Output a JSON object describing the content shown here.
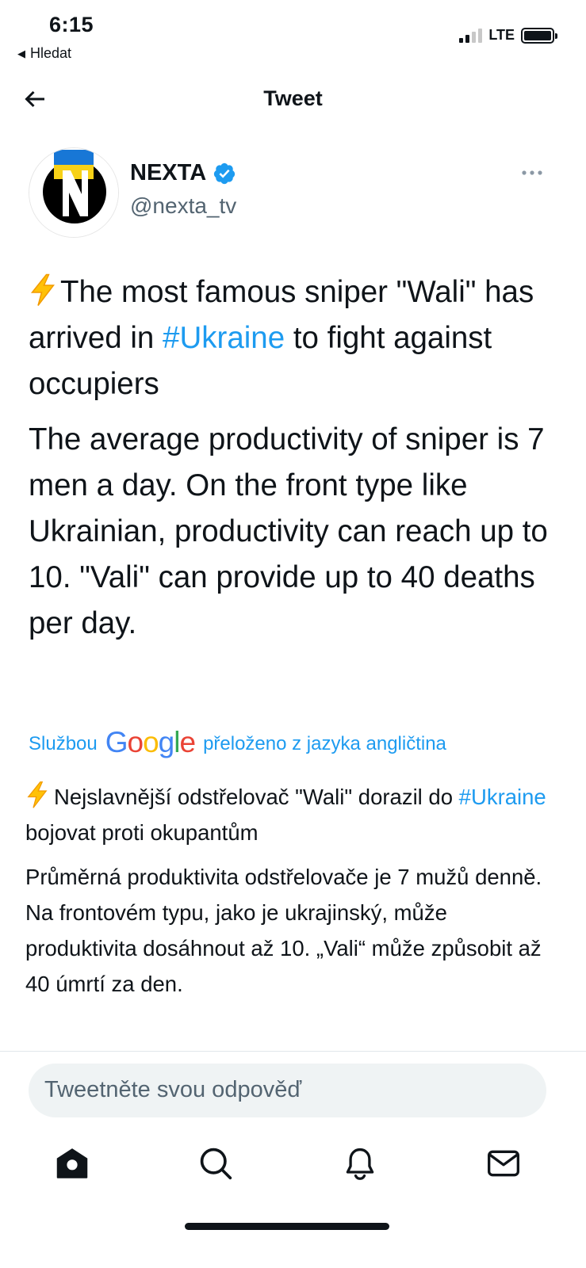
{
  "status_bar": {
    "time": "6:15",
    "back_app": "Hledat",
    "network": "LTE"
  },
  "header": {
    "title": "Tweet"
  },
  "author": {
    "name": "NEXTA",
    "handle": "@nexta_tv",
    "verified": true
  },
  "tweet": {
    "p1_part1": "The most famous sniper \"Wali\" has arrived in ",
    "p1_hashtag": "#Ukraine",
    "p1_part2": " to fight against occupiers",
    "p2": "The average productivity of sniper is 7 men a day.  On the front type like Ukrainian, productivity can reach up to 10. \"Vali\" can provide up to 40 deaths per day."
  },
  "translation": {
    "prefix": "Službou",
    "provider": "Google",
    "suffix": "přeloženo z jazyka angličtina",
    "p1_part1": "Nejslavnější odstřelovač \"Wali\" dorazil do ",
    "p1_hashtag": "#Ukraine",
    "p1_part2": " bojovat proti okupantům",
    "p2": " Průměrná produktivita odstřelovače je 7 mužů denně. Na frontovém typu, jako je ukrajinský, může produktivita dosáhnout až 10. „Vali“ může způsobit až 40 úmrtí za den."
  },
  "reply": {
    "placeholder": "Tweetněte svou odpověď"
  },
  "colors": {
    "accent": "#1d9bf0",
    "text": "#0f1419",
    "secondary": "#536471"
  },
  "tabs": [
    "home-icon",
    "search-icon",
    "notifications-icon",
    "messages-icon"
  ]
}
